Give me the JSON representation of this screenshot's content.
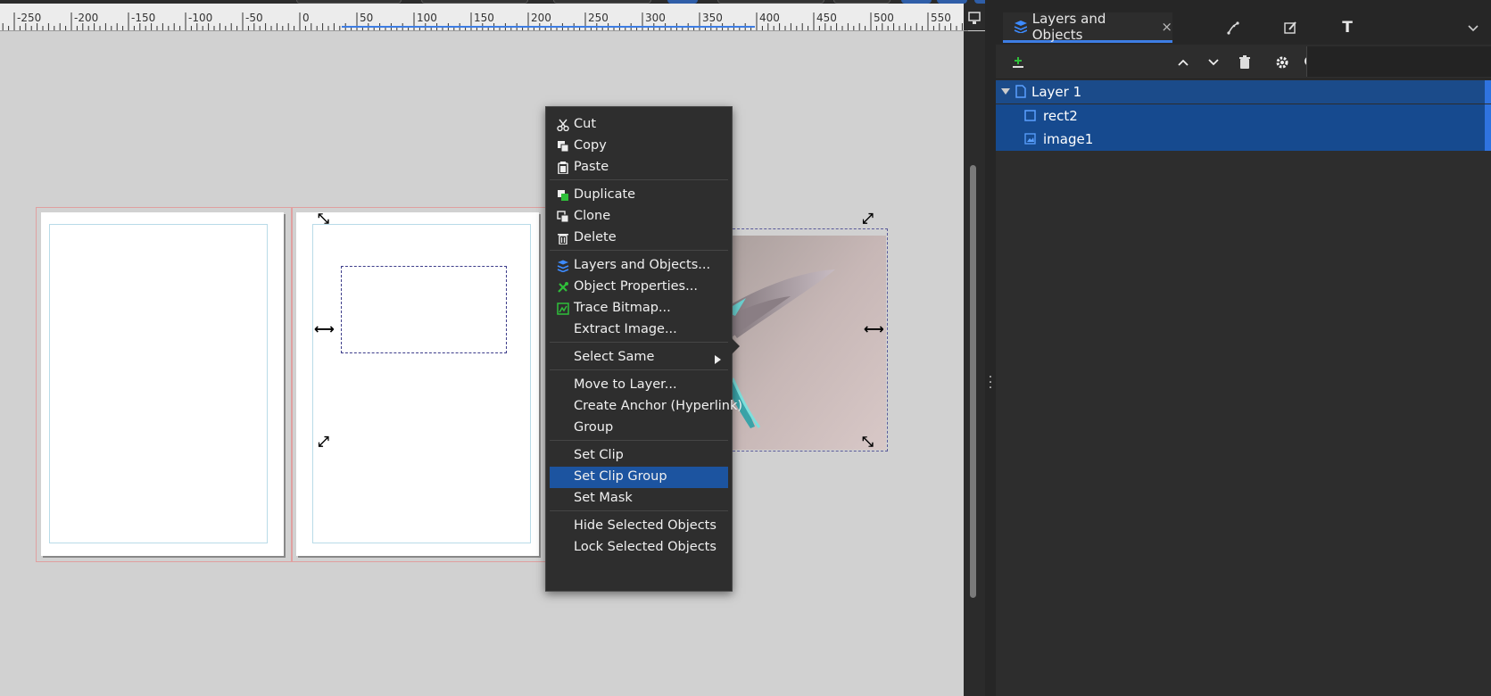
{
  "ruler": {
    "labels": [
      "-250",
      "-200",
      "-150",
      "-100",
      "-50",
      "0",
      "50",
      "100",
      "150",
      "200",
      "250",
      "300",
      "350",
      "400",
      "450",
      "500",
      "550"
    ]
  },
  "panel": {
    "tab_title": "Layers and Objects",
    "tab_close": "×",
    "other_tab_icons": [
      "node-tool-icon",
      "edit-icon",
      "text-tool-icon"
    ],
    "toolbar_icons": [
      "add-layer-icon",
      "move-up-icon",
      "move-down-icon",
      "delete-icon",
      "settings-icon",
      "search-icon"
    ]
  },
  "tree": {
    "items": [
      {
        "label": "Layer 1",
        "icon": "layer-icon",
        "expanded": true
      },
      {
        "label": "rect2",
        "icon": "rect-icon"
      },
      {
        "label": "image1",
        "icon": "image-icon"
      }
    ]
  },
  "context_menu": {
    "items": [
      {
        "label": "Cut",
        "icon": "scissors-icon"
      },
      {
        "label": "Copy",
        "icon": "copy-icon"
      },
      {
        "label": "Paste",
        "icon": "paste-icon"
      },
      {
        "label": "Duplicate",
        "icon": "duplicate-icon"
      },
      {
        "label": "Clone",
        "icon": "clone-icon"
      },
      {
        "label": "Delete",
        "icon": "trash-icon"
      },
      {
        "label": "Layers and Objects...",
        "icon": "layers-icon"
      },
      {
        "label": "Object Properties...",
        "icon": "object-properties-icon"
      },
      {
        "label": "Trace Bitmap...",
        "icon": "trace-bitmap-icon"
      },
      {
        "label": "Extract Image...",
        "icon": ""
      },
      {
        "label": "Select Same",
        "icon": "",
        "submenu": true
      },
      {
        "label": "Move to Layer...",
        "icon": ""
      },
      {
        "label": "Create Anchor (Hyperlink)",
        "icon": ""
      },
      {
        "label": "Group",
        "icon": ""
      },
      {
        "label": "Set Clip",
        "icon": ""
      },
      {
        "label": "Set Clip Group",
        "icon": "",
        "highlighted": true
      },
      {
        "label": "Set Mask",
        "icon": ""
      },
      {
        "label": "Hide Selected Objects",
        "icon": ""
      },
      {
        "label": "Lock Selected Objects",
        "icon": ""
      }
    ]
  },
  "colors": {
    "accent": "#3d7de4",
    "selection": "#1b4b8a",
    "menu_bg": "#2e2e2e",
    "highlight": "#1c54a0",
    "canvas": "#d1d1d1"
  }
}
